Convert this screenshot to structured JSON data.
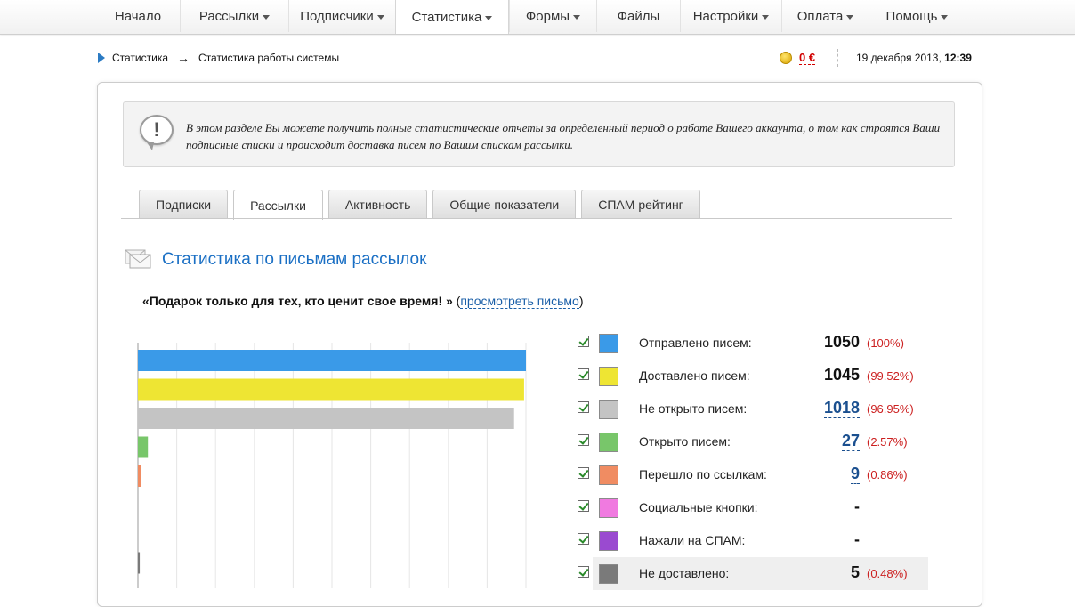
{
  "nav": {
    "items": [
      {
        "label": "Начало",
        "caret": false,
        "active": false
      },
      {
        "label": "Рассылки",
        "caret": true,
        "active": false
      },
      {
        "label": "Подписчики",
        "caret": true,
        "active": false
      },
      {
        "label": "Статистика",
        "caret": true,
        "active": true
      },
      {
        "label": "Формы",
        "caret": true,
        "active": false
      },
      {
        "label": "Файлы",
        "caret": false,
        "active": false
      },
      {
        "label": "Настройки",
        "caret": true,
        "active": false
      },
      {
        "label": "Оплата",
        "caret": true,
        "active": false
      },
      {
        "label": "Помощь",
        "caret": true,
        "active": false
      }
    ]
  },
  "breadcrumb": {
    "root": "Статистика",
    "arrow": "→",
    "current": "Статистика работы системы"
  },
  "balance": {
    "value": "0 €",
    "icon": "coins-icon"
  },
  "datetime": {
    "date": "19 декабря 2013,",
    "time": "12:39"
  },
  "notice": {
    "icon": "exclamation-bubble-icon",
    "text": "В этом разделе Вы можете получить полные статистические отчеты за определенный период о работе Вашего аккаунта, о том как строятся Ваши подписные списки и происходит доставка писем по Вашим спискам рассылки."
  },
  "tabs": [
    {
      "label": "Подписки",
      "active": false
    },
    {
      "label": "Рассылки",
      "active": true
    },
    {
      "label": "Активность",
      "active": false
    },
    {
      "label": "Общие показатели",
      "active": false
    },
    {
      "label": "СПАМ рейтинг",
      "active": false
    }
  ],
  "section": {
    "title": "Статистика по письмам рассылок",
    "icon": "envelope-icon"
  },
  "letter": {
    "open_quote": "«Подарок только для тех, кто ценит свое время! »",
    "paren_open": " (",
    "link": "просмотреть письмо",
    "paren_close": ")"
  },
  "chart_data": {
    "type": "bar",
    "orientation": "horizontal",
    "xlim": [
      0,
      1050
    ],
    "grid": true,
    "categories": [
      "Отправлено писем:",
      "Доставлено писем:",
      "Не открыто писем:",
      "Открыто писем:",
      "Перешло по ссылкам:",
      "Социальные кнопки:",
      "Нажали на СПАМ:",
      "Не доставлено:"
    ],
    "values": [
      1050,
      1045,
      1018,
      27,
      9,
      0,
      0,
      5
    ],
    "colors": [
      "#3a9ae8",
      "#eee533",
      "#c4c4c4",
      "#78c66a",
      "#f08c62",
      "#f07ae0",
      "#9a4ad0",
      "#7a7a7a"
    ]
  },
  "legend": [
    {
      "label": "Отправлено писем:",
      "value": "1050",
      "pct": "(100%)",
      "color": "#3a9ae8",
      "link": false,
      "highlight": false
    },
    {
      "label": "Доставлено писем:",
      "value": "1045",
      "pct": "(99.52%)",
      "color": "#eee533",
      "link": false,
      "highlight": false
    },
    {
      "label": "Не открыто писем:",
      "value": "1018",
      "pct": "(96.95%)",
      "color": "#c4c4c4",
      "link": true,
      "highlight": false
    },
    {
      "label": "Открыто писем:",
      "value": "27",
      "pct": "(2.57%)",
      "color": "#78c66a",
      "link": true,
      "highlight": false
    },
    {
      "label": "Перешло по ссылкам:",
      "value": "9",
      "pct": "(0.86%)",
      "color": "#f08c62",
      "link": true,
      "highlight": false
    },
    {
      "label": "Социальные кнопки:",
      "value": "-",
      "pct": "",
      "color": "#f07ae0",
      "link": false,
      "highlight": false
    },
    {
      "label": "Нажали на СПАМ:",
      "value": "-",
      "pct": "",
      "color": "#9a4ad0",
      "link": false,
      "highlight": false
    },
    {
      "label": "Не доставлено:",
      "value": "5",
      "pct": "(0.48%)",
      "color": "#7a7a7a",
      "link": false,
      "highlight": true
    }
  ]
}
